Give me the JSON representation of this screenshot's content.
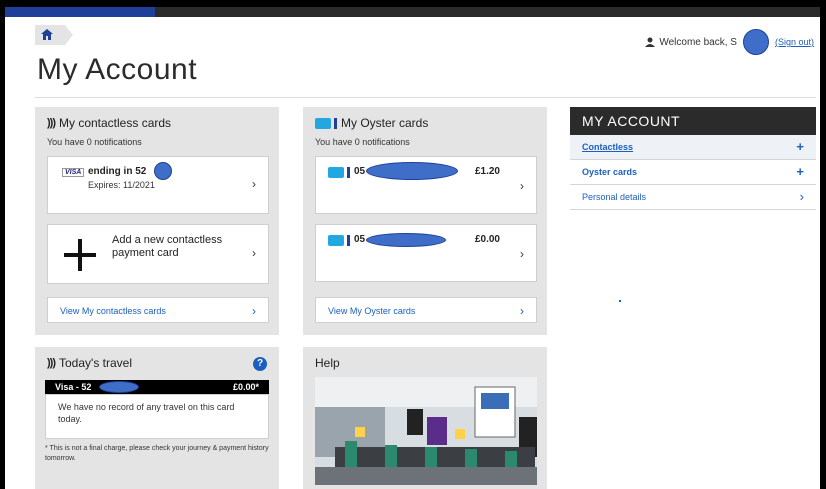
{
  "header": {
    "welcome_text": "Welcome back, S",
    "sign_out": "(Sign out)"
  },
  "page_title": "My Account",
  "contactless": {
    "title": "My contactless cards",
    "notifications": "You have 0 notifications",
    "card_brand": "VISA",
    "card_ending": "ending in 52",
    "card_expires": "Expires: 11/2021",
    "add_label": "Add a new contactless payment card",
    "view_link": "View My contactless cards"
  },
  "oyster": {
    "title": "My Oyster cards",
    "notifications": "You have 0 notifications",
    "cards": [
      {
        "number": "05",
        "balance": "£1.20"
      },
      {
        "number": "05",
        "balance": "£0.00"
      }
    ],
    "view_link": "View My Oyster cards"
  },
  "nav": {
    "heading": "MY ACCOUNT",
    "items": [
      {
        "label": "Contactless",
        "sign": "+"
      },
      {
        "label": "Oyster cards",
        "sign": "+"
      },
      {
        "label": "Personal details",
        "sign": "›"
      }
    ]
  },
  "travel": {
    "title": "Today's travel",
    "card_label": "Visa - 52",
    "amount": "£0.00*",
    "message": "We have no record of any travel on this card today.",
    "footnote": "* This is not a final charge, please check your journey & payment history tomorrow.",
    "help_glyph": "?"
  },
  "help": {
    "title": "Help"
  },
  "icons": {
    "chevron": "›"
  },
  "colors": {
    "link_blue": "#1d5fbf",
    "panel_grey": "#e4e4e4",
    "nav_dark": "#2b2b2b",
    "oyster_cyan": "#22a7e0"
  }
}
